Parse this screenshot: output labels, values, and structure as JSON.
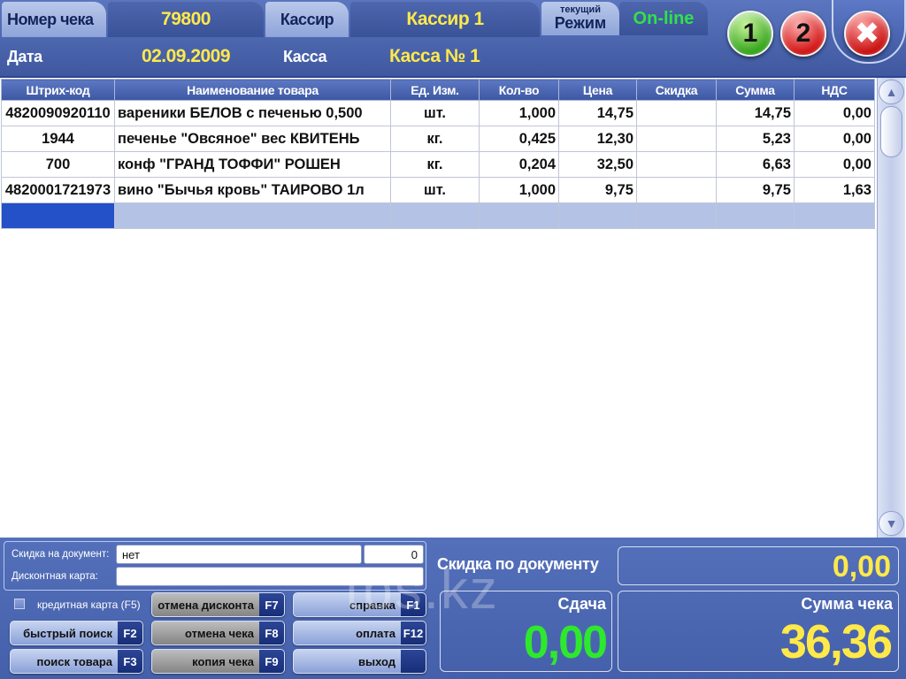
{
  "header": {
    "receipt_no_label": "Номер чека",
    "receipt_no": "79800",
    "cashier_label": "Кассир",
    "cashier": "Кассир 1",
    "mode_small": "текущий",
    "mode_label": "Режим",
    "mode_value": "On-line",
    "date_label": "Дата",
    "date": "02.09.2009",
    "register_label": "Касса",
    "register": "Касса № 1",
    "btn1": "1",
    "btn2": "2",
    "close_symbol": "✖"
  },
  "table": {
    "columns": [
      "Штрих-код",
      "Наименование товара",
      "Ед. Изм.",
      "Кол-во",
      "Цена",
      "Скидка",
      "Сумма",
      "НДС"
    ],
    "rows": [
      [
        "4820090920110",
        "вареники БЕЛОВ с печенью 0,500",
        "шт.",
        "1,000",
        "14,75",
        "",
        "14,75",
        "0,00"
      ],
      [
        "1944",
        "печенье \"Овсяное\" вес КВИТЕНЬ",
        "кг.",
        "0,425",
        "12,30",
        "",
        "5,23",
        "0,00"
      ],
      [
        "700",
        "конф  \"ГРАНД ТОФФИ\" РОШЕН",
        "кг.",
        "0,204",
        "32,50",
        "",
        "6,63",
        "0,00"
      ],
      [
        "4820001721973",
        "вино \"Бычья кровь\" ТАИРОВО 1л",
        "шт.",
        "1,000",
        "9,75",
        "",
        "9,75",
        "1,63"
      ]
    ]
  },
  "discount": {
    "doc_label": "Скидка на документ:",
    "doc_value": "нет",
    "doc_amount": "0",
    "card_label": "Дисконтная карта:",
    "card_value": ""
  },
  "credit_card_label": "кредитная карта (F5)",
  "buttons": {
    "cancel_discount": {
      "label": "отмена дисконта",
      "key": "F7"
    },
    "help": {
      "label": "справка",
      "key": "F1"
    },
    "quick_search": {
      "label": "быстрый поиск",
      "key": "F2"
    },
    "cancel_receipt": {
      "label": "отмена чека",
      "key": "F8"
    },
    "payment": {
      "label": "оплата",
      "key": "F12"
    },
    "find_product": {
      "label": "поиск товара",
      "key": "F3"
    },
    "copy_receipt": {
      "label": "копия чека",
      "key": "F9"
    },
    "exit": {
      "label": "выход",
      "key": ""
    }
  },
  "summary": {
    "doc_discount_label": "Скидка по документу",
    "doc_discount_value": "0,00",
    "change_label": "Сдача",
    "change_value": "0,00",
    "total_label": "Сумма чека",
    "total_value": "36,36"
  },
  "watermark": "tbs.kz",
  "colors": {
    "accent_yellow": "#ffe94a",
    "online_green": "#2fe24a",
    "panel_blue": "#4a63a8"
  }
}
